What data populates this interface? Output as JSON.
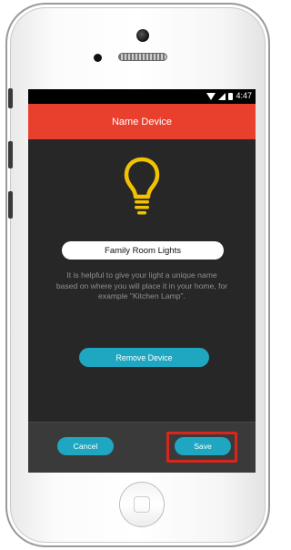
{
  "status_bar": {
    "time": "4:47",
    "icons": [
      "wifi-icon",
      "signal-icon",
      "battery-icon"
    ]
  },
  "header": {
    "title": "Name Device"
  },
  "device_icon": "lightbulb-icon",
  "name_field": {
    "value": "Family Room Lights"
  },
  "help_text": "It is helpful to give your light a unique name based on where you will place it in your home, for example \"Kitchen Lamp\".",
  "buttons": {
    "remove": "Remove Device",
    "cancel": "Cancel",
    "save": "Save"
  },
  "colors": {
    "header_red": "#e9402e",
    "button_teal": "#1fa7c1",
    "bulb_yellow": "#f2c200",
    "background": "#272727",
    "highlight_red": "#d9261c"
  }
}
